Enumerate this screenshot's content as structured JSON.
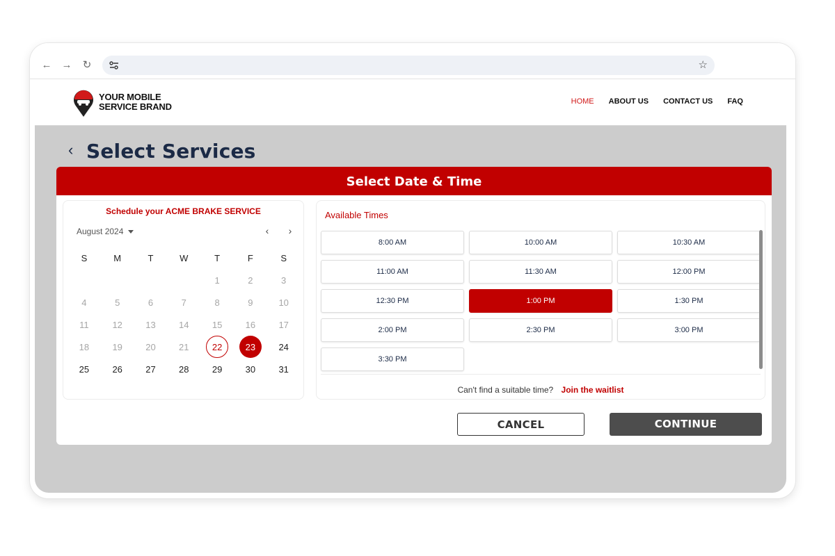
{
  "browser": {
    "back_icon": "arrow-left-icon",
    "forward_icon": "arrow-right-icon",
    "reload_icon": "reload-icon",
    "site_info_icon": "tune-icon",
    "bookmark_icon": "star-icon"
  },
  "header": {
    "brand_line1": "YOUR MOBILE",
    "brand_line2": "SERVICE BRAND",
    "nav": {
      "home": "HOME",
      "about": "ABOUT US",
      "contact": "CONTACT US",
      "faq": "FAQ"
    },
    "accent_color": "#d11a1a"
  },
  "page": {
    "title": "Select Services"
  },
  "panel": {
    "header": "Select Date & Time",
    "header_color": "#c10000"
  },
  "calendar": {
    "title": "Schedule your ACME BRAKE SERVICE",
    "month": "August 2024",
    "weekdays": [
      "S",
      "M",
      "T",
      "W",
      "T",
      "F",
      "S"
    ],
    "today": "22",
    "selected": "23"
  },
  "times": {
    "title": "Available Times",
    "slots": [
      "8:00 AM",
      "10:00 AM",
      "10:30 AM",
      "11:00 AM",
      "11:30 AM",
      "12:00 PM",
      "12:30 PM",
      "1:00 PM",
      "1:30 PM",
      "2:00 PM",
      "2:30 PM",
      "3:00 PM",
      "3:30 PM"
    ],
    "selected": "1:00 PM",
    "waitlist_prompt": "Can't find a suitable time?",
    "waitlist_link": "Join the waitlist"
  },
  "actions": {
    "cancel": "CANCEL",
    "continue": "CONTINUE"
  }
}
